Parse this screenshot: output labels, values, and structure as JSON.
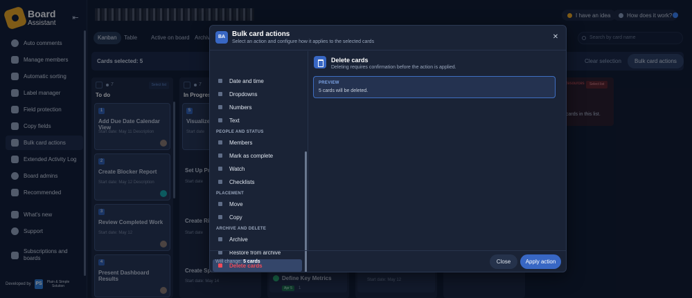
{
  "app": {
    "title": "Board",
    "subtitle": "Assistant"
  },
  "sidebar": {
    "items": [
      {
        "label": "Auto comments",
        "icon": "comment-icon"
      },
      {
        "label": "Manage members",
        "icon": "users-icon"
      },
      {
        "label": "Automatic sorting",
        "icon": "sort-icon"
      },
      {
        "label": "Label manager",
        "icon": "label-icon"
      },
      {
        "label": "Field protection",
        "icon": "lock-icon"
      },
      {
        "label": "Copy fields",
        "icon": "copy-icon"
      },
      {
        "label": "Bulk card actions",
        "icon": "bulk-icon",
        "active": true
      },
      {
        "label": "Extended Activity Log",
        "icon": "log-icon"
      },
      {
        "label": "Board admins",
        "icon": "admin-icon"
      },
      {
        "label": "Recommended",
        "icon": "diamond-icon"
      }
    ],
    "secondary": [
      {
        "label": "What's new",
        "icon": "rocket-icon"
      },
      {
        "label": "Support",
        "icon": "support-icon"
      }
    ],
    "subscriptions": "Subscriptions and boards",
    "developed_by": "Developed by",
    "developer_logo": "PS",
    "developer_name": "Plain & Simple Solution"
  },
  "topbar": {
    "idea": "I have an idea",
    "how": "How does it work?"
  },
  "board": {
    "tabs": [
      "Kanban",
      "Table",
      "Active on board",
      "Archive"
    ],
    "search_placeholder": "Search by card name",
    "selected_text": "Cards selected: 5",
    "clear_selection": "Clear selection",
    "bulk_actions": "Bulk card actions",
    "select_list": "Select list",
    "lists": [
      {
        "title": "To do",
        "count": "7",
        "cards": [
          {
            "num": "1",
            "title": "Add Due Date Calendar View",
            "meta": "Start date: May 11   Description"
          },
          {
            "num": "2",
            "title": "Create Blocker Report",
            "meta": "Start date: May 12   Description"
          },
          {
            "num": "3",
            "title": "Review Completed Work",
            "meta": "Start date: May 12"
          },
          {
            "num": "4",
            "title": "Present Dashboard Results",
            "meta": ""
          }
        ]
      },
      {
        "title": "In Progress",
        "count": "7",
        "cards": [
          {
            "num": "5",
            "title": "Visualize T",
            "meta": "Start date"
          }
        ],
        "plain": [
          {
            "title": "Set Up Prio",
            "meta": "Start date"
          },
          {
            "title": "Create Risk",
            "meta": "Start date"
          },
          {
            "title": "Create Sprin",
            "meta": "Start date: May 14"
          }
        ]
      }
    ],
    "under_modal": {
      "define_title": "Define Key Metrics",
      "define_tag": "Apr 5",
      "define_count": "1",
      "start_date": "Start date: May 12"
    },
    "right_list": {
      "badge": "Resources",
      "empty": "cards in this list."
    }
  },
  "modal": {
    "badge": "BA",
    "title": "Bulk card actions",
    "subtitle": "Select an action and configure how it applies to the selected cards",
    "groups": {
      "people": "PEOPLE AND STATUS",
      "placement": "PLACEMENT",
      "archive": "ARCHIVE AND DELETE"
    },
    "actions": {
      "date_time": "Date and time",
      "dropdowns": "Dropdowns",
      "numbers": "Numbers",
      "text": "Text",
      "members": "Members",
      "mark_complete": "Mark as complete",
      "watch": "Watch",
      "checklists": "Checklists",
      "move": "Move",
      "copy": "Copy",
      "archive": "Archive",
      "restore": "Restore from archive",
      "delete": "Delete cards"
    },
    "detail": {
      "title": "Delete cards",
      "subtitle": "Deleting requires confirmation before the action is applied.",
      "preview_label": "PREVIEW",
      "preview_text": "5 cards will be deleted."
    },
    "footer": {
      "will_change": "Will change:",
      "count": "5 cards",
      "close": "Close",
      "apply": "Apply action"
    }
  },
  "colors": {
    "accent": "#3867c4",
    "danger": "#f04b5a",
    "brand": "#f0a81c"
  }
}
